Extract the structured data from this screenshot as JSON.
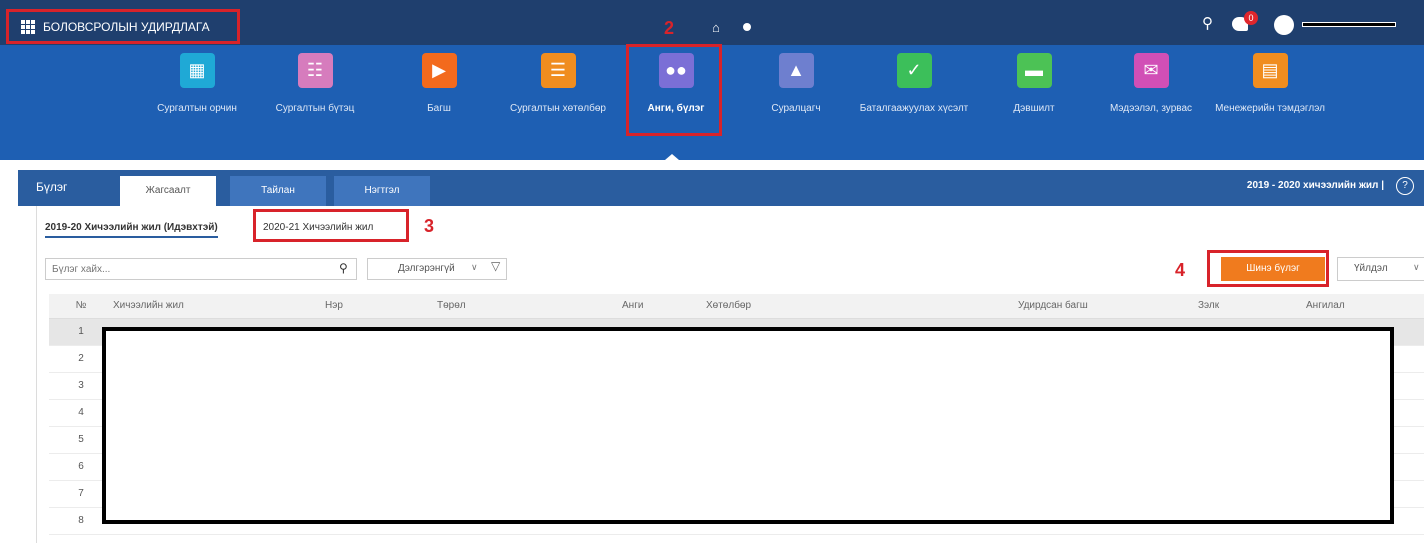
{
  "app": {
    "title": "БОЛОВСРОЛЫН УДИРДЛАГА"
  },
  "topbar": {
    "notification_count": "0"
  },
  "modules": [
    {
      "label": "Сургалтын орчин",
      "icon": "building-icon",
      "color": "#1fa9d6"
    },
    {
      "label": "Сургалтын бүтэц",
      "icon": "org-chart-icon",
      "color": "#d67cbd"
    },
    {
      "label": "Багш",
      "icon": "teacher-icon",
      "color": "#f36a1d"
    },
    {
      "label": "Сургалтын хөтөлбөр",
      "icon": "books-icon",
      "color": "#f08d1f"
    },
    {
      "label": "Анги, бүлэг",
      "icon": "group-icon",
      "color": "#7b6fd6",
      "active": true
    },
    {
      "label": "Суралцагч",
      "icon": "student-icon",
      "color": "#6e7fcf"
    },
    {
      "label": "Баталгаажуулах хүсэлт",
      "icon": "approval-icon",
      "color": "#3cbf5a"
    },
    {
      "label": "Дэвшилт",
      "icon": "progress-icon",
      "color": "#4cc255"
    },
    {
      "label": "Мэдээлэл, зурвас",
      "icon": "message-icon",
      "color": "#d14fb6"
    },
    {
      "label": "Менежерийн тэмдэглэл",
      "icon": "notebook-icon",
      "color": "#f08d1f"
    }
  ],
  "annotations": [
    "2",
    "3",
    "4"
  ],
  "section": {
    "title": "Бүлэг",
    "tabs": [
      "Жагсаалт",
      "Тайлан",
      "Нэгтгэл"
    ],
    "academic_year": "2019 - 2020 хичээлийн жил |",
    "help": "?"
  },
  "year_tabs": [
    "2019-20 Хичээлийн жил (Идэвхтэй)",
    "2020-21 Хичээлийн жил"
  ],
  "toolbar": {
    "search_placeholder": "Бүлэг хайх...",
    "detail": "Дэлгэрэнгүй",
    "new_button": "Шинэ бүлэг",
    "action": "Үйлдэл"
  },
  "table": {
    "headers": [
      "№",
      "Хичээлийн жил",
      "Нэр",
      "Төрөл",
      "Анги",
      "Хөтөлбөр",
      "Удирдсан багш",
      "Зэлк",
      "Ангилал"
    ],
    "rows": [
      "1",
      "2",
      "3",
      "4",
      "5",
      "6",
      "7",
      "8"
    ]
  }
}
